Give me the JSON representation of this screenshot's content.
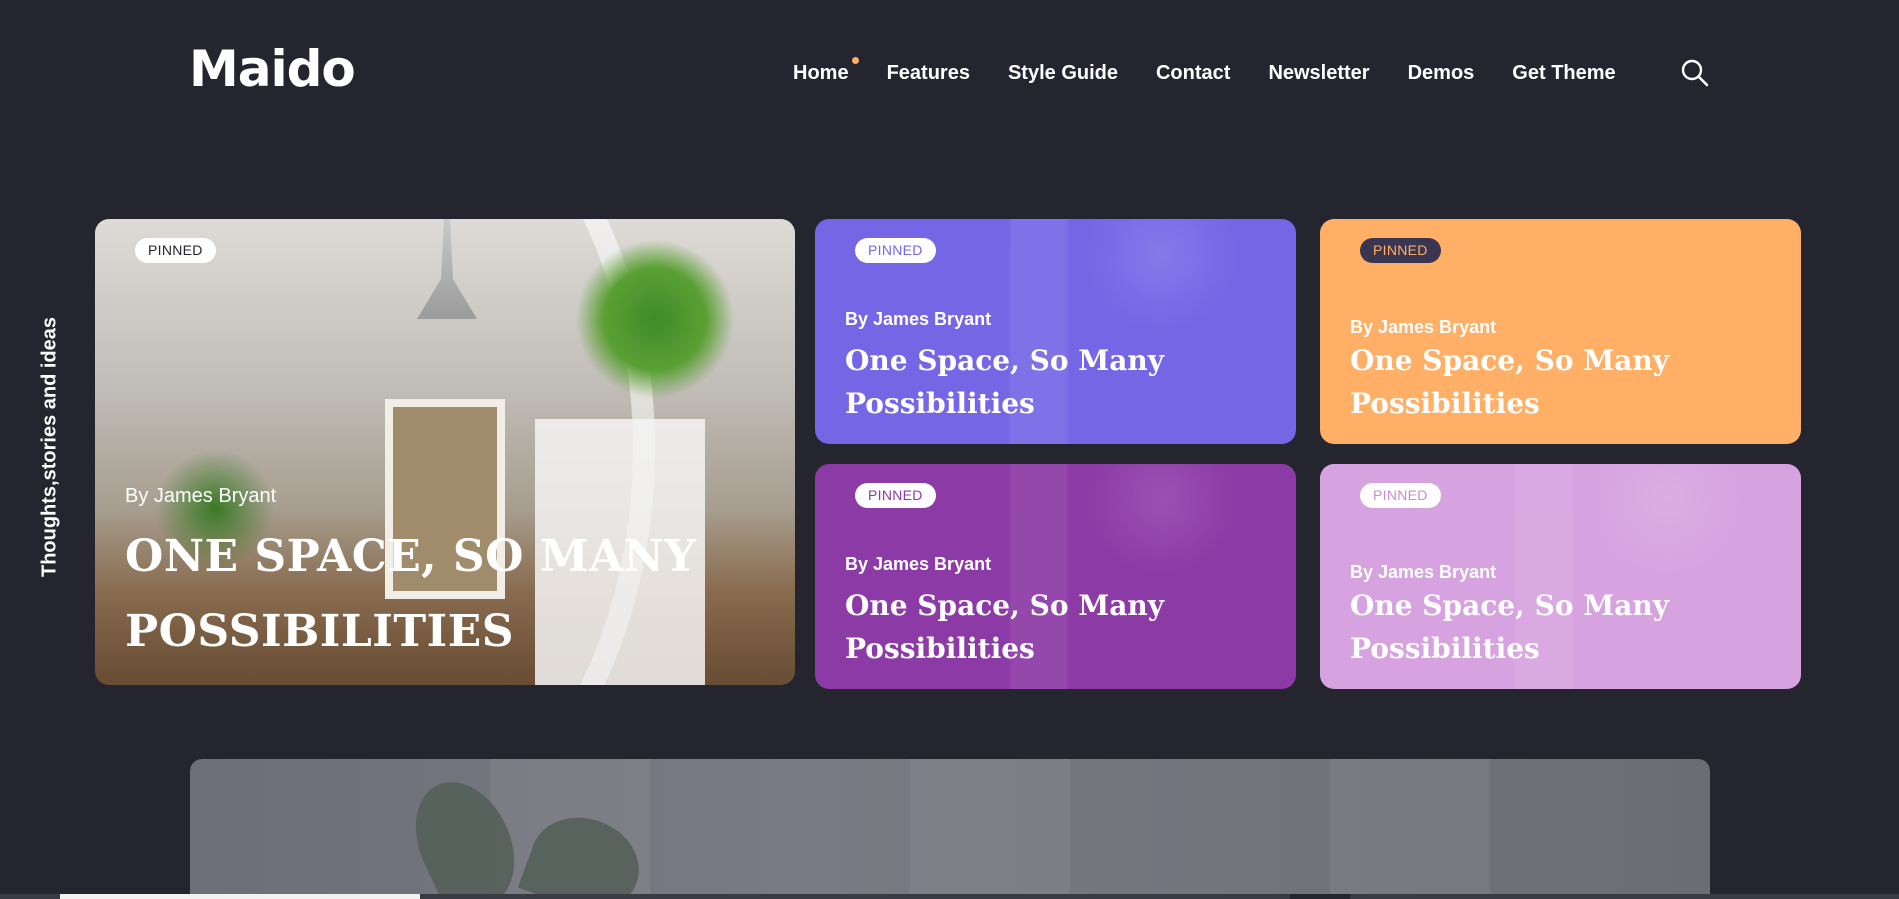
{
  "header": {
    "logo": "Maido",
    "nav": [
      {
        "label": "Home"
      },
      {
        "label": "Features"
      },
      {
        "label": "Style Guide"
      },
      {
        "label": "Contact"
      },
      {
        "label": "Newsletter"
      },
      {
        "label": "Demos"
      },
      {
        "label": "Get Theme"
      }
    ],
    "search_icon": "search-icon"
  },
  "tagline": "Thoughts,stories and ideas",
  "featured": {
    "badge": "PINNED",
    "author": "By James Bryant",
    "title": "ONE SPACE, SO MANY POSSIBILITIES"
  },
  "cards": [
    {
      "badge": "PINNED",
      "author": "By James Bryant",
      "title": "One Space, So Many Possibilities",
      "color": "#7566e6"
    },
    {
      "badge": "PINNED",
      "author": "By James Bryant",
      "title": "One Space, So Many Possibilities",
      "color": "#ffb066"
    },
    {
      "badge": "PINNED",
      "author": "By James Bryant",
      "title": "One Space, So Many Possibilities",
      "color": "#8c3aa6"
    },
    {
      "badge": "PINNED",
      "author": "By James Bryant",
      "title": "One Space, So Many Possibilities",
      "color": "#d7a2e0"
    }
  ],
  "colors": {
    "background": "#252530",
    "accent_dot": "#ffb066"
  }
}
